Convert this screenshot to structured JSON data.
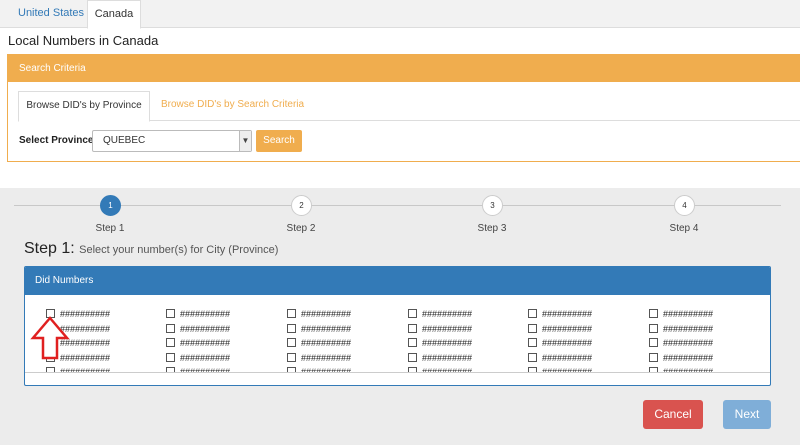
{
  "country_tabs": [
    {
      "label": "United States",
      "active": false
    },
    {
      "label": "Canada",
      "active": true
    }
  ],
  "page_title": "Local Numbers in Canada",
  "search_criteria": {
    "header": "Search Criteria",
    "tabs": [
      {
        "label": "Browse DID's by Province",
        "active": true
      },
      {
        "label": "Browse DID's by Search Criteria",
        "active": false
      }
    ],
    "province_label": "Select Province",
    "province_value": "QUEBEC",
    "search_button": "Search"
  },
  "stepper": {
    "steps": [
      {
        "number": "1",
        "label": "Step 1",
        "active": true
      },
      {
        "number": "2",
        "label": "Step 2",
        "active": false
      },
      {
        "number": "3",
        "label": "Step 3",
        "active": false
      },
      {
        "number": "4",
        "label": "Step 4",
        "active": false
      }
    ]
  },
  "step_heading": {
    "title": "Step 1:",
    "subtitle": "Select your number(s) for City (Province)"
  },
  "did_panel": {
    "header": "Did Numbers",
    "columns": [
      [
        "##########",
        "##########",
        "##########",
        "##########",
        "##########"
      ],
      [
        "##########",
        "##########",
        "##########",
        "##########",
        "##########"
      ],
      [
        "##########",
        "##########",
        "##########",
        "##########",
        "##########"
      ],
      [
        "##########",
        "##########",
        "##########",
        "##########",
        "##########"
      ],
      [
        "##########",
        "##########",
        "##########",
        "##########",
        "##########"
      ],
      [
        "##########",
        "##########",
        "##########",
        "##########",
        "##########"
      ]
    ]
  },
  "buttons": {
    "cancel": "Cancel",
    "next": "Next"
  },
  "colors": {
    "primary": "#337ab7",
    "warning": "#f0ad4e",
    "danger": "#d9534f",
    "arrow": "#e02020"
  }
}
